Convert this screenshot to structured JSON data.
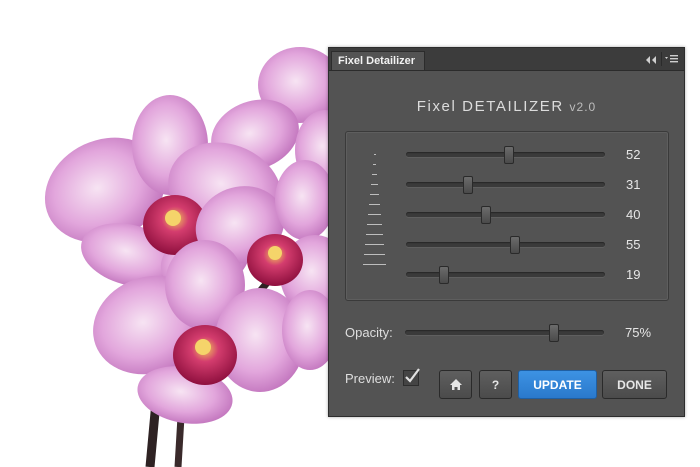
{
  "panel": {
    "tab_label": "Fixel Detailizer",
    "title_main": "Fixel DETAILIZER",
    "title_version": "v2.0",
    "collapse_icon": "double-chevron-left-icon",
    "menu_icon": "panel-menu-icon"
  },
  "sliders": [
    {
      "value": 52,
      "label": "52"
    },
    {
      "value": 31,
      "label": "31"
    },
    {
      "value": 40,
      "label": "40"
    },
    {
      "value": 55,
      "label": "55"
    },
    {
      "value": 19,
      "label": "19"
    }
  ],
  "opacity": {
    "label": "Opacity:",
    "value": 75,
    "value_label": "75%"
  },
  "preview": {
    "label": "Preview:",
    "checked": true
  },
  "buttons": {
    "home_icon": "home-icon",
    "help_label": "?",
    "update_label": "UPDATE",
    "done_label": "DONE"
  },
  "colors": {
    "panel_bg": "#535353",
    "accent": "#2a79cc",
    "orchid": "#d98fd0",
    "orchid_center": "#c2185b"
  }
}
